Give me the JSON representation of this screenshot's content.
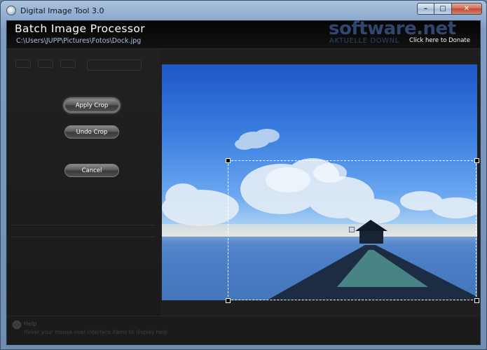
{
  "window": {
    "title": "Digital Image Tool 3.0",
    "caption_buttons": {
      "minimize": "–",
      "maximize": "□",
      "close": "✕"
    }
  },
  "header": {
    "app_title": "Batch Image Processor",
    "file_path": "C:\\Users\\JUPP\\Pictures\\Fotos\\Dock.jpg",
    "watermark_logo": "software.net",
    "watermark_sub": "AKTUELLE DOWNL",
    "donate_link": "Click here to Donate"
  },
  "left_panel": {
    "apply_crop_label": "Apply Crop",
    "undo_crop_label": "Undo Crop",
    "cancel_label": "Cancel"
  },
  "help": {
    "title": "Help",
    "text": "Hover your mouse over interface items to display help"
  },
  "colors": {
    "header_bg": "#0a0a0a",
    "panel_bg": "#1f1f1f",
    "path_text": "#a9c3e6",
    "crop_border": "#ffffff"
  }
}
